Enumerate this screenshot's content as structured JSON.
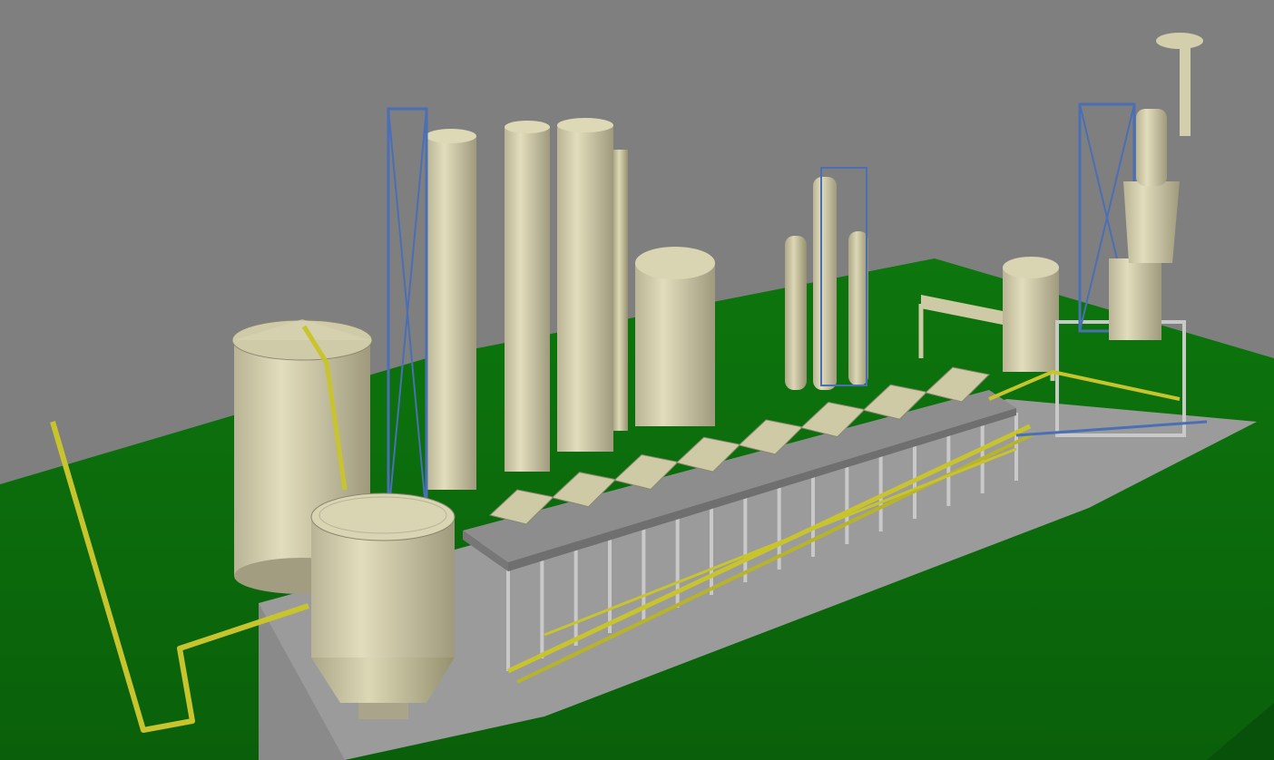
{
  "viewport": {
    "background_color": "#7f7f7f",
    "ground_color": "#0b6b0b",
    "ground_shadow_color": "#0a5f0a",
    "slab_color": "#9a9a9a",
    "deck_color": "#8e8e8e",
    "vessel_color": "#d3ceab",
    "vessel_shadow_color": "#b3ae8c",
    "pipe_color": "#c8c42e",
    "steel_color": "#4a6fb5",
    "accent_color": "#c83232",
    "rail_color": "#d8d8d8",
    "column_color": "#c9c9c9"
  },
  "scene": {
    "objects": [
      {
        "name": "ground-plane"
      },
      {
        "name": "foundation-slab"
      },
      {
        "name": "process-deck"
      },
      {
        "name": "pipe-rack"
      },
      {
        "name": "storage-silo-large"
      },
      {
        "name": "storage-silo-hopper"
      },
      {
        "name": "tall-column-1"
      },
      {
        "name": "tall-column-2"
      },
      {
        "name": "tall-column-3"
      },
      {
        "name": "storage-tank-domed"
      },
      {
        "name": "slim-column-pair"
      },
      {
        "name": "distillation-tower"
      },
      {
        "name": "gantry-crane"
      },
      {
        "name": "overhead-pipe-loop"
      }
    ]
  }
}
